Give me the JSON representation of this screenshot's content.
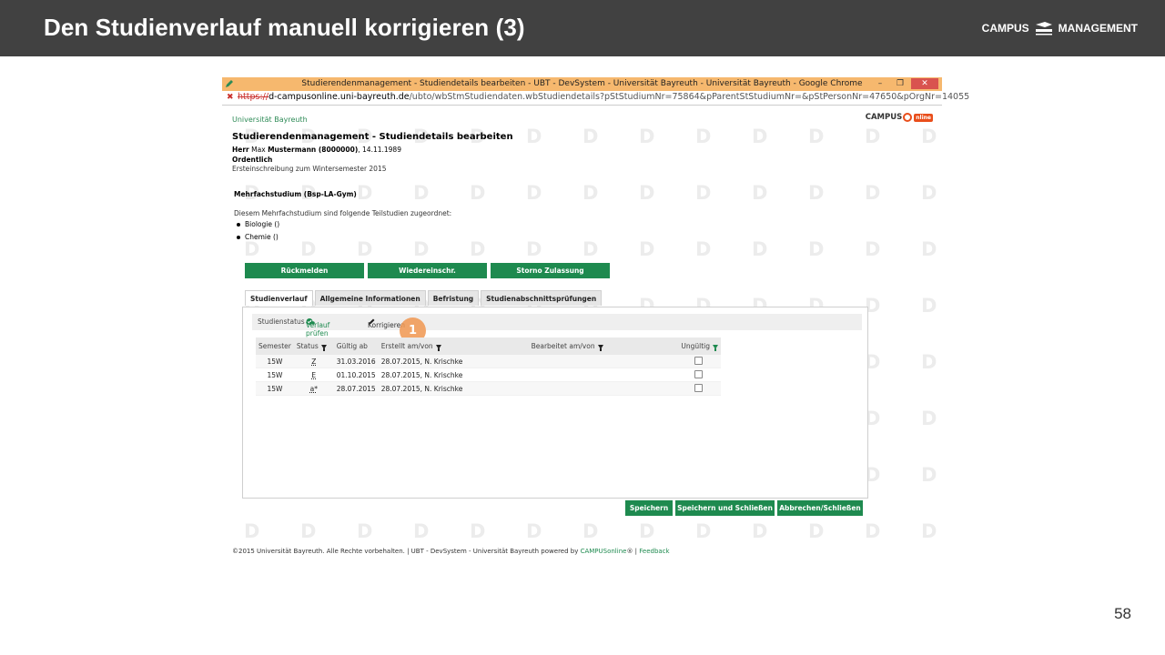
{
  "slide": {
    "title": "Den Studienverlauf manuell korrigieren (3)",
    "brand_left": "CAMPUS",
    "brand_right": "MANAGEMENT",
    "page_number": "58"
  },
  "browser": {
    "window_title": "Studierendenmanagement - Studiendetails bearbeiten - UBT - DevSystem - Universität Bayreuth - Universität Bayreuth - Google Chrome",
    "url_scheme": "https://",
    "url_host": "d-campusonline.uni-bayreuth.de",
    "url_path": "/ubto/wbStmStudiendaten.wbStudiendetails?pStStudiumNr=75864&pParentStStudiumNr=&pStPersonNr=47650&pOrgNr=14055",
    "controls": [
      "–",
      "❐",
      "✕"
    ]
  },
  "page": {
    "university": "Universität Bayreuth",
    "logo_text_left": "CAMPUS",
    "logo_text_right": "nline",
    "heading": "Studierendenmanagement - Studiendetails bearbeiten",
    "person": {
      "salutation": "Herr",
      "first_name": "Max",
      "last_name_id": "Mustermann (8000000)",
      "birthdate": ", 14.11.1989"
    },
    "study_type": "Ordentlich",
    "enrollment": "Ersteinschreibung zum Wintersemester 2015",
    "mehrfachstudium": "Mehrfachstudium (Bsp-LA-Gym)",
    "intro": "Diesem Mehrfachstudium sind folgende Teilstudien zugeordnet:",
    "teilstudien": [
      "Biologie ()",
      "Chemie ()"
    ],
    "buttons": [
      "Rückmelden",
      "Wiedereinschr.",
      "Storno Zulassung"
    ],
    "tabs": [
      "Studienverlauf",
      "Allgemeine Informationen",
      "Befristung",
      "Studienabschnittsprüfungen"
    ],
    "active_tab": "Studienverlauf",
    "toolbar": {
      "label": "Studienstatus",
      "verlauf": "Verlauf prüfen",
      "korrigieren": "Korrigieren"
    },
    "marker": "1",
    "table": {
      "headers": [
        "Semester",
        "Status",
        "Gültig ab",
        "Erstellt am/von",
        "Bearbeitet am/von",
        "Ungültig"
      ],
      "rows": [
        {
          "semester": "15W",
          "status": "Z",
          "gueltig_ab": "31.03.2016",
          "erstellt": "28.07.2015, N. Krischke",
          "bearbeitet": "",
          "ungueltig": false
        },
        {
          "semester": "15W",
          "status": "E",
          "gueltig_ab": "01.10.2015",
          "erstellt": "28.07.2015, N. Krischke",
          "bearbeitet": "",
          "ungueltig": false
        },
        {
          "semester": "15W",
          "status": "a*",
          "gueltig_ab": "28.07.2015",
          "erstellt": "28.07.2015, N. Krischke",
          "bearbeitet": "",
          "ungueltig": false
        }
      ]
    },
    "save_buttons": [
      "Speichern",
      "Speichern und Schließen",
      "Abbrechen/Schließen"
    ],
    "footer": {
      "text": "©2015 Universität Bayreuth. Alle Rechte vorbehalten. | UBT - DevSystem - Universität Bayreuth powered by ",
      "link1": "CAMPUSonline",
      "reg": "® | ",
      "link2": "Feedback"
    },
    "watermark_letter": "D"
  },
  "colors": {
    "header_bg": "#414141",
    "green": "#1e8a4f",
    "browser_titlebar": "#f6b86e",
    "marker": "#f0964f"
  }
}
